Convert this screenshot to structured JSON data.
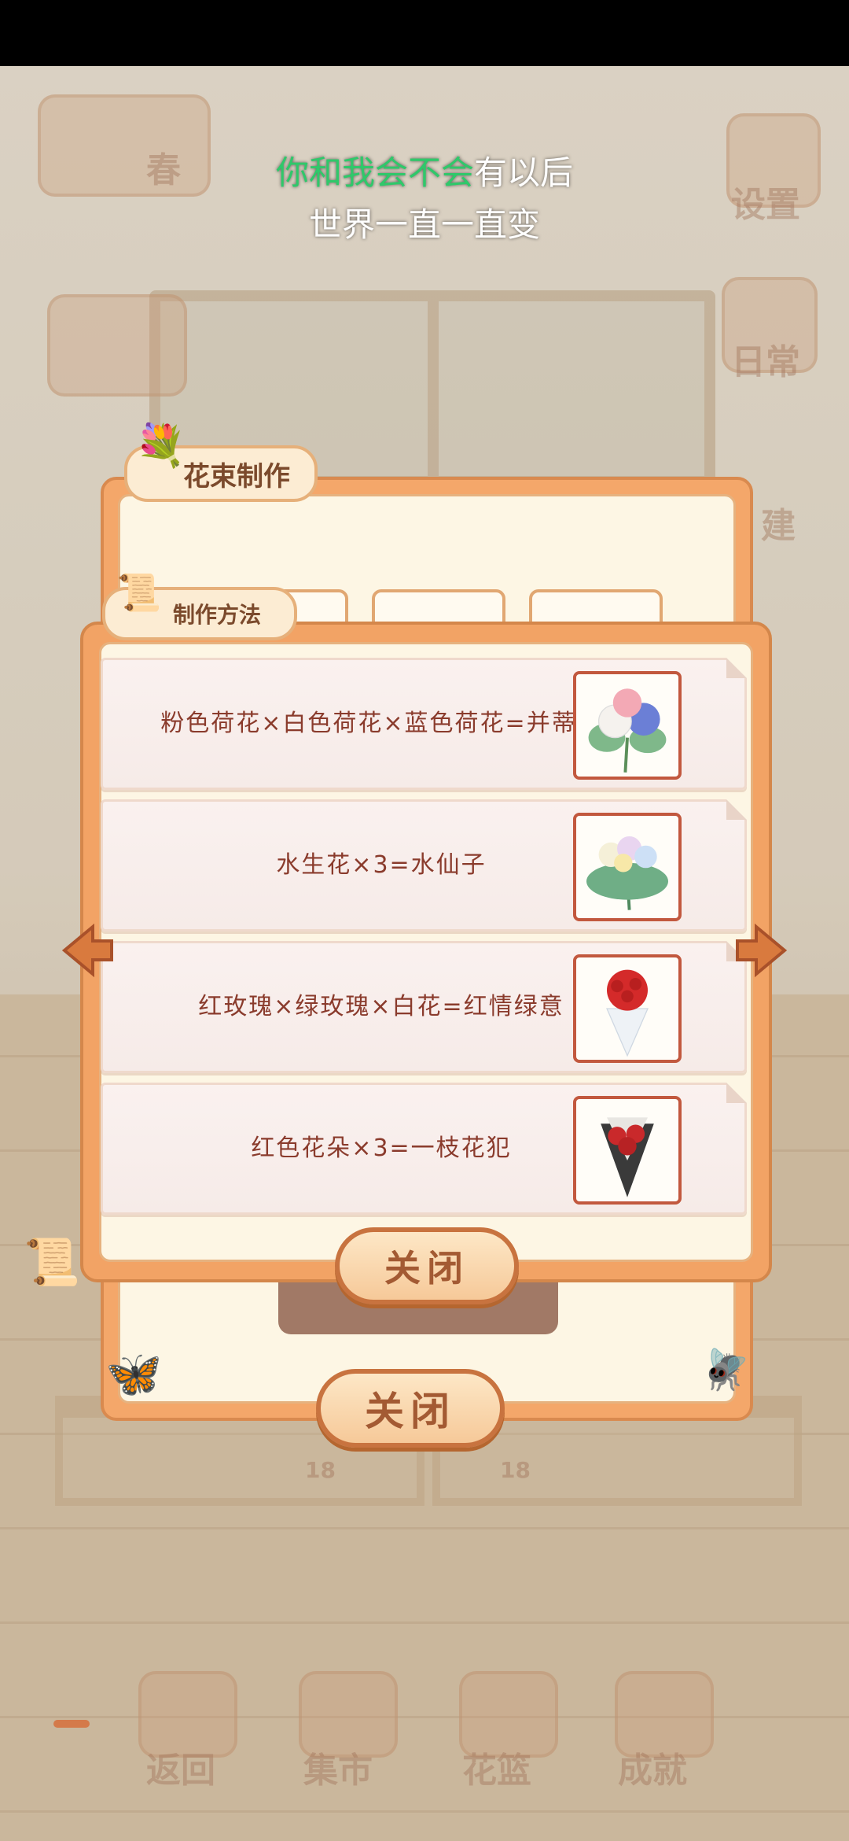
{
  "lyrics": {
    "line1_sung": "你和我会不会",
    "line1_rest": "有以后",
    "line2": "世界一直一直变"
  },
  "background": {
    "season": "春",
    "menu": [
      "设置",
      "日常",
      "建"
    ],
    "bottom_nav": [
      "返回",
      "集市",
      "花篮",
      "成就"
    ],
    "price_tags": [
      "18",
      "18"
    ]
  },
  "bouquet_panel": {
    "tab_label": "花束制作",
    "close_label": "关闭"
  },
  "method_panel": {
    "tab_label": "制作方法",
    "close_label": "关闭",
    "recipes": [
      {
        "text": "粉色荷花×白色荷花×蓝色荷花=并蒂莲",
        "icon": "lotus-bouquet-icon"
      },
      {
        "text": "水生花×3=水仙子",
        "icon": "water-flower-bouquet-icon"
      },
      {
        "text": "红玫瑰×绿玫瑰×白花=红情绿意",
        "icon": "red-rose-bouquet-icon"
      },
      {
        "text": "红色花朵×3=一枝花犯",
        "icon": "red-flower-bouquet-icon"
      }
    ]
  },
  "colors": {
    "accent": "#f2a365",
    "text_recipe": "#8a3b2c",
    "lyric_highlight": "#2fc86a"
  }
}
